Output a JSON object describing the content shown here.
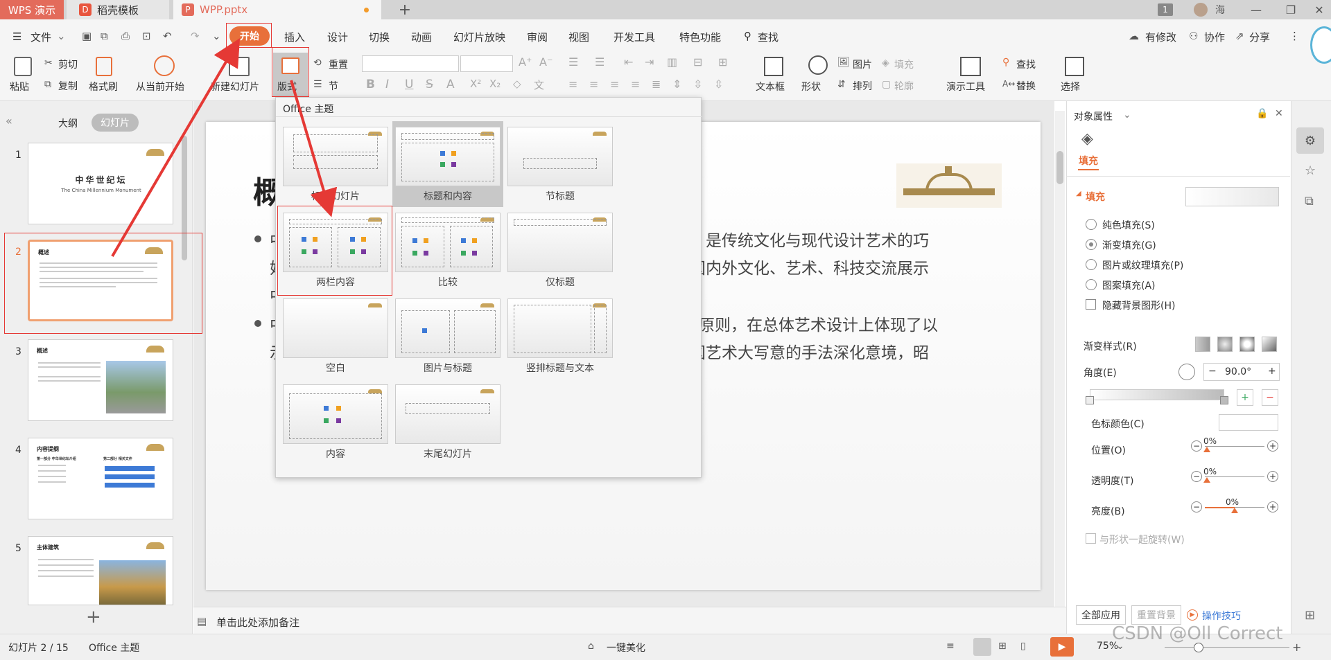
{
  "tabs": {
    "app": "WPS 演示",
    "daoke": "稻壳模板",
    "file": "WPP.pptx",
    "add": "+"
  },
  "window": {
    "user": "海",
    "badge": "1"
  },
  "menu": {
    "file": "文件",
    "items": [
      "开始",
      "插入",
      "设计",
      "切换",
      "动画",
      "幻灯片放映",
      "审阅",
      "视图",
      "开发工具",
      "特色功能"
    ],
    "search": "查找",
    "right": [
      "有修改",
      "协作",
      "分享"
    ]
  },
  "ribbon": {
    "paste": "粘贴",
    "cut": "剪切",
    "copy": "复制",
    "format_painter": "格式刷",
    "from_current": "从当前开始",
    "new_slide": "新建幻灯片",
    "layout": "版式",
    "reset": "重置",
    "section": "节",
    "picture": "图片",
    "fill": "填充",
    "find": "查找",
    "textbox": "文本框",
    "shape": "形状",
    "arrange": "排列",
    "outline": "轮廓",
    "present_tools": "演示工具",
    "replace": "替换",
    "select": "选择"
  },
  "left_panel": {
    "outline_tab": "大纲",
    "slides_tab": "幻灯片",
    "add": "+"
  },
  "thumbnails": [
    {
      "num": "1",
      "title": "中华世纪坛",
      "subtitle": "The China Millennium Monument"
    },
    {
      "num": "2",
      "title": "概述"
    },
    {
      "num": "3",
      "title": "概述"
    },
    {
      "num": "4",
      "title": "内容提纲",
      "sub1": "第一部分 中华世纪坛介绍",
      "sub2": "第二部分 相关文件"
    },
    {
      "num": "5",
      "title": "主体建筑"
    }
  ],
  "slide": {
    "title_char": "概",
    "line1": "建筑，是传统文化与现代设计艺术的巧",
    "line2": "还是国内外文化、艺术、科技交流展示",
    "line3": "美原则，在总体艺术设计上体现了以",
    "line4": "和中国艺术大写意的手法深化意境，昭",
    "frag1": "中",
    "frag2": "妙",
    "frag3": "中",
    "frag4": "中",
    "frag5": "示"
  },
  "layout_dropdown": {
    "header": "Office 主题",
    "items": [
      "标题幻灯片",
      "标题和内容",
      "节标题",
      "两栏内容",
      "比较",
      "仅标题",
      "空白",
      "图片与标题",
      "竖排标题与文本",
      "内容",
      "末尾幻灯片"
    ]
  },
  "right_panel": {
    "title": "对象属性",
    "tab": "填充",
    "section": "填充",
    "options": [
      "纯色填充(S)",
      "渐变填充(G)",
      "图片或纹理填充(P)",
      "图案填充(A)"
    ],
    "hide_bg": "隐藏背景图形(H)",
    "gradient_style": "渐变样式(R)",
    "angle_label": "角度(E)",
    "angle_value": "90.0°",
    "stop_color": "色标颜色(C)",
    "position": "位置(O)",
    "transparency": "透明度(T)",
    "brightness": "亮度(B)",
    "position_value": "0%",
    "transparency_value": "0%",
    "brightness_value": "0%",
    "rotate_with_shape": "与形状一起旋转(W)",
    "apply_all": "全部应用",
    "reset_bg": "重置背景",
    "tips": "操作技巧"
  },
  "notes": {
    "placeholder": "单击此处添加备注"
  },
  "status": {
    "slide_count": "幻灯片 2 / 15",
    "theme": "Office 主题",
    "beautify": "一键美化",
    "zoom": "75%",
    "watermark": "CSDN @Oll Correct"
  },
  "colors": {
    "accent": "#e8703a",
    "annotation": "#e53935",
    "wps_red": "#e36b5b"
  }
}
